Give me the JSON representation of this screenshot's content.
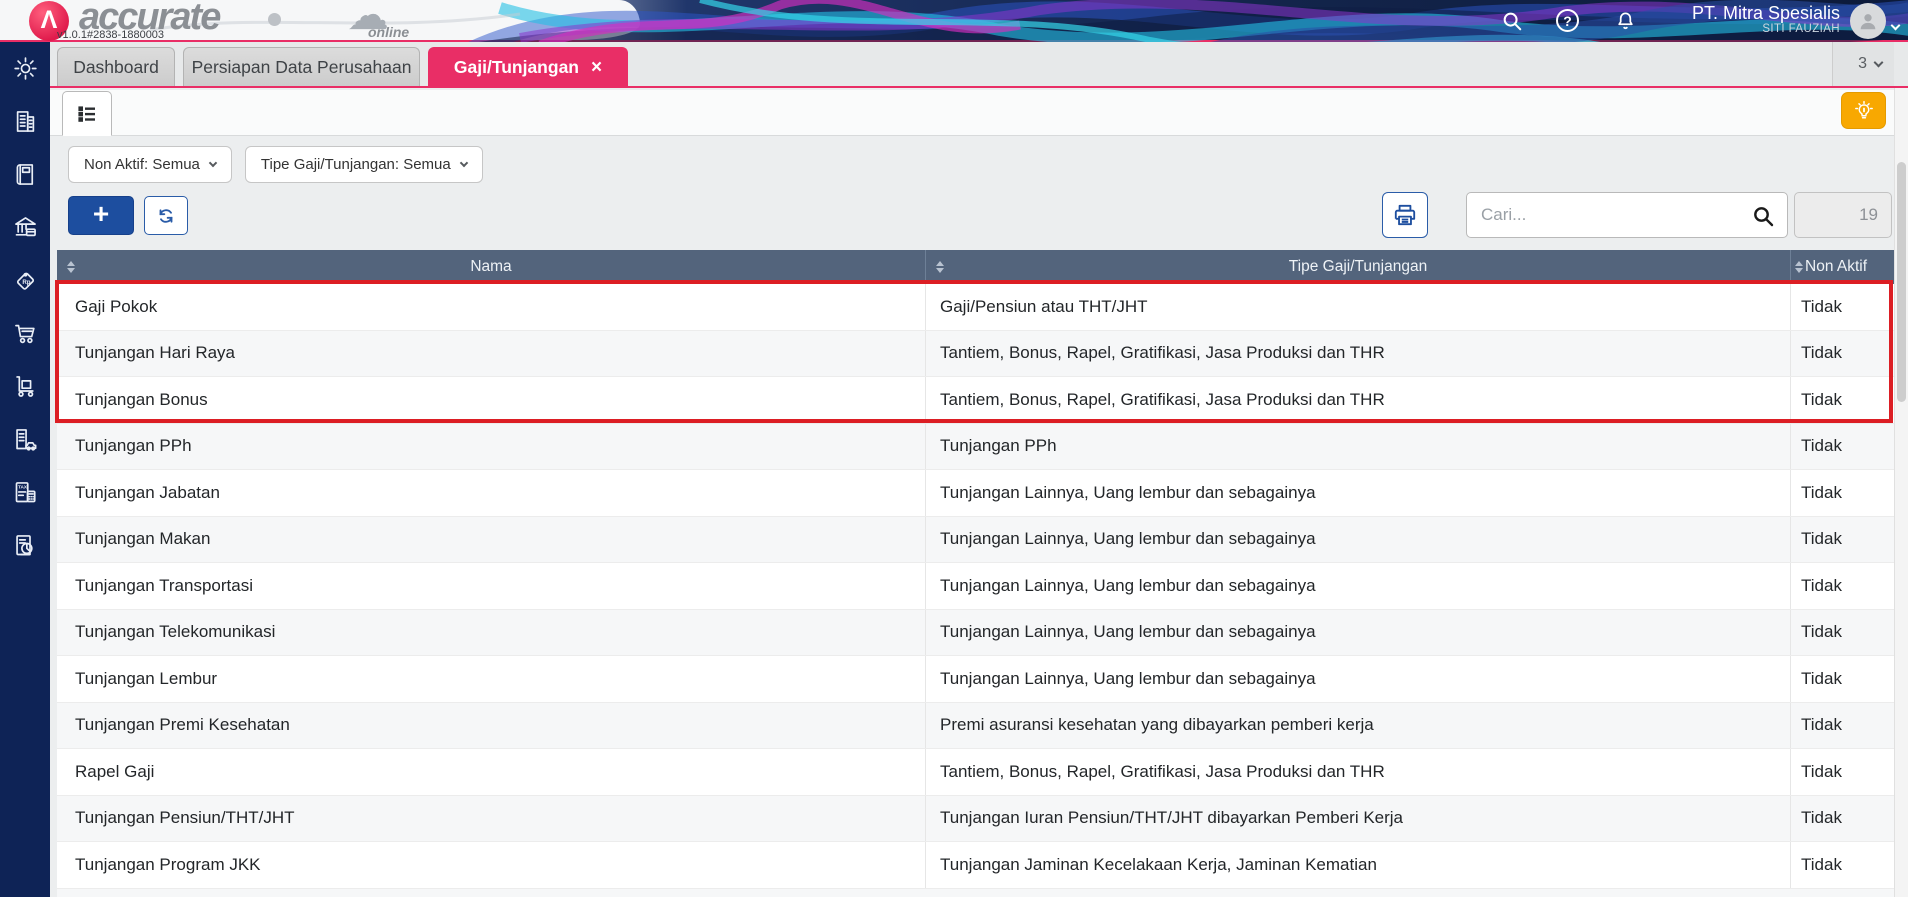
{
  "colors": {
    "accent_pink": "#e92e66",
    "highlight_red": "#dc1e24",
    "sidebar_navy": "#0e2356",
    "table_header_slate": "#53647c",
    "add_button_blue": "#1d4e9f",
    "tips_orange": "#f8a801"
  },
  "topbar": {
    "logo_text": "accurate",
    "logo_online": "online",
    "version": "v1.0.1#2838-1880003",
    "company_name": "PT. Mitra Spesialis",
    "user_name": "SITI FAUZIAH",
    "icons": [
      "search-icon",
      "help-icon",
      "notifications-bell-icon",
      "avatar",
      "chevron-down-icon"
    ]
  },
  "tabbar": {
    "tabs": [
      {
        "label": "Dashboard",
        "active": false
      },
      {
        "label": "Persiapan Data Perusahaan",
        "active": false
      },
      {
        "label": "Gaji/Tunjangan",
        "active": true,
        "close_icon": "close-icon"
      }
    ],
    "open_tab_count": "3"
  },
  "sidebar": {
    "items": [
      {
        "icon": "gear-icon"
      },
      {
        "icon": "company-building-icon"
      },
      {
        "icon": "ledger-book-icon"
      },
      {
        "icon": "bank-icon"
      },
      {
        "icon": "price-tag-rp-icon"
      },
      {
        "icon": "shopping-cart-icon"
      },
      {
        "icon": "inventory-trolley-icon"
      },
      {
        "icon": "fixed-asset-icon"
      },
      {
        "icon": "tax-document-icon"
      },
      {
        "icon": "report-chart-icon"
      }
    ]
  },
  "toolbar": {
    "view_tab_icon": "list-view-icon",
    "tips_icon": "lightbulb-icon",
    "filters": [
      {
        "label": "Non Aktif: Semua"
      },
      {
        "label": "Tipe Gaji/Tunjangan: Semua"
      }
    ],
    "add_icon": "plus-icon",
    "refresh_icon": "refresh-icon",
    "print_icon": "printer-icon",
    "search_placeholder": "Cari...",
    "record_count": "19"
  },
  "table": {
    "columns": [
      {
        "label": "Nama"
      },
      {
        "label": "Tipe Gaji/Tunjangan"
      },
      {
        "label": "Non Aktif"
      }
    ],
    "highlighted_row_indexes": [
      0,
      1,
      2
    ],
    "rows": [
      {
        "name": "Gaji Pokok",
        "tipe": "Gaji/Pensiun atau THT/JHT",
        "non_aktif": "Tidak"
      },
      {
        "name": "Tunjangan Hari Raya",
        "tipe": "Tantiem, Bonus, Rapel, Gratifikasi, Jasa Produksi dan THR",
        "non_aktif": "Tidak"
      },
      {
        "name": "Tunjangan Bonus",
        "tipe": "Tantiem, Bonus, Rapel, Gratifikasi, Jasa Produksi dan THR",
        "non_aktif": "Tidak"
      },
      {
        "name": "Tunjangan PPh",
        "tipe": "Tunjangan PPh",
        "non_aktif": "Tidak"
      },
      {
        "name": "Tunjangan Jabatan",
        "tipe": "Tunjangan Lainnya, Uang lembur dan sebagainya",
        "non_aktif": "Tidak"
      },
      {
        "name": "Tunjangan Makan",
        "tipe": "Tunjangan Lainnya, Uang lembur dan sebagainya",
        "non_aktif": "Tidak"
      },
      {
        "name": "Tunjangan Transportasi",
        "tipe": "Tunjangan Lainnya, Uang lembur dan sebagainya",
        "non_aktif": "Tidak"
      },
      {
        "name": "Tunjangan Telekomunikasi",
        "tipe": "Tunjangan Lainnya, Uang lembur dan sebagainya",
        "non_aktif": "Tidak"
      },
      {
        "name": "Tunjangan Lembur",
        "tipe": "Tunjangan Lainnya, Uang lembur dan sebagainya",
        "non_aktif": "Tidak"
      },
      {
        "name": "Tunjangan Premi Kesehatan",
        "tipe": "Premi asuransi kesehatan yang dibayarkan pemberi kerja",
        "non_aktif": "Tidak"
      },
      {
        "name": "Rapel Gaji",
        "tipe": "Tantiem, Bonus, Rapel, Gratifikasi, Jasa Produksi dan THR",
        "non_aktif": "Tidak"
      },
      {
        "name": "Tunjangan Pensiun/THT/JHT",
        "tipe": "Tunjangan Iuran Pensiun/THT/JHT dibayarkan Pemberi Kerja",
        "non_aktif": "Tidak"
      },
      {
        "name": "Tunjangan Program JKK",
        "tipe": "Tunjangan Jaminan Kecelakaan Kerja, Jaminan Kematian",
        "non_aktif": "Tidak"
      }
    ]
  }
}
